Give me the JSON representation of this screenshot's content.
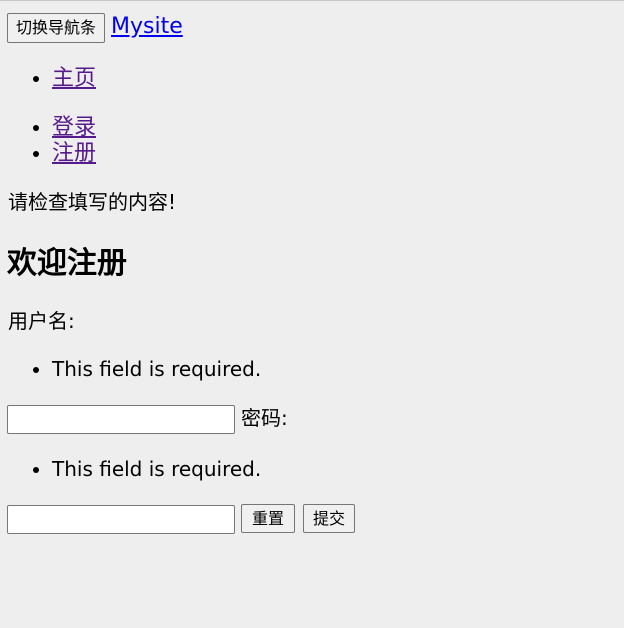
{
  "navbar": {
    "toggle_label": "切换导航条",
    "brand": "Mysite",
    "left_items": [
      {
        "label": "主页"
      }
    ],
    "right_items": [
      {
        "label": "登录"
      },
      {
        "label": "注册"
      }
    ]
  },
  "alert": "请检查填写的内容!",
  "form": {
    "title": "欢迎注册",
    "username_label": "用户名:",
    "username_error": "This field is required.",
    "username_value": "",
    "password_label": "密码:",
    "password_error": "This field is required.",
    "password_value": "",
    "reset_label": "重置",
    "submit_label": "提交"
  }
}
